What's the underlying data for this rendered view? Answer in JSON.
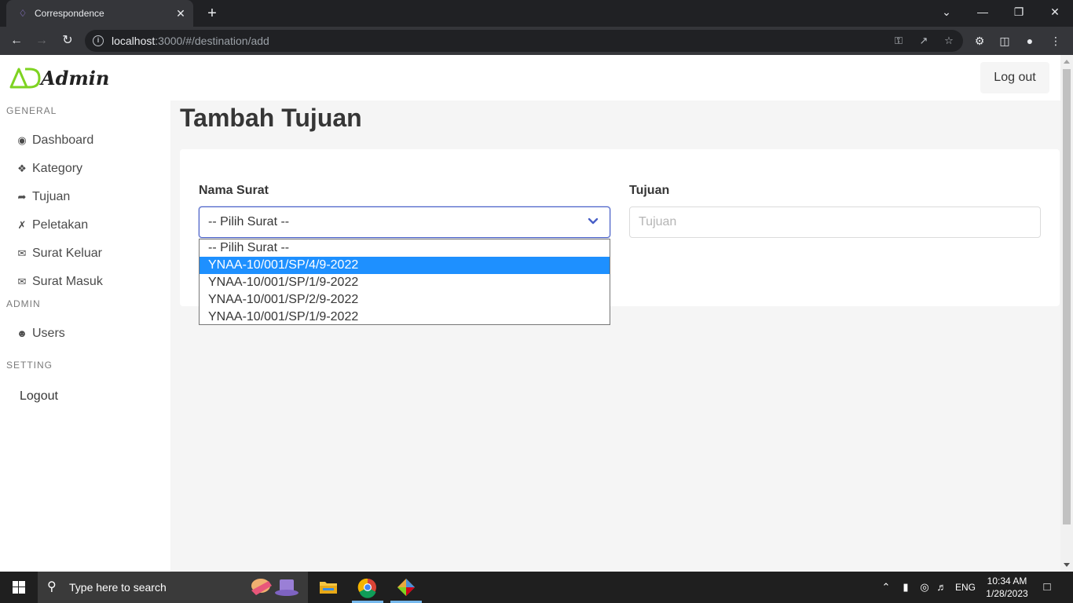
{
  "browser": {
    "tab_title": "Correspondence",
    "url_host": "localhost",
    "url_rest": ":3000/#/destination/add"
  },
  "app": {
    "logo_text": "Admin",
    "logo_mark": "AD",
    "logout_button": "Log out"
  },
  "sidebar": {
    "general_label": "GENERAL",
    "admin_label": "ADMIN",
    "setting_label": "SETTING",
    "items": [
      {
        "label": "Dashboard",
        "icon": "gauge-icon"
      },
      {
        "label": "Kategory",
        "icon": "tags-icon"
      },
      {
        "label": "Tujuan",
        "icon": "share-icon"
      },
      {
        "label": "Peletakan",
        "icon": "xing-icon"
      },
      {
        "label": "Surat Keluar",
        "icon": "envelope-icon"
      },
      {
        "label": "Surat Masuk",
        "icon": "envelope-open-icon"
      }
    ],
    "admin_items": [
      {
        "label": "Users",
        "icon": "user-icon"
      }
    ],
    "setting_items": [
      {
        "label": "Logout"
      }
    ]
  },
  "main": {
    "page_title": "Tambah Tujuan",
    "nama_surat_label": "Nama Surat",
    "tujuan_label": "Tujuan",
    "select_value": "-- Pilih Surat --",
    "tujuan_placeholder": "Tujuan",
    "options": [
      "-- Pilih Surat --",
      "YNAA-10/001/SP/4/9-2022",
      "YNAA-10/001/SP/1/9-2022",
      "YNAA-10/001/SP/2/9-2022",
      "YNAA-10/001/SP/1/9-2022"
    ],
    "highlighted_option_index": 1
  },
  "taskbar": {
    "search_placeholder": "Type here to search",
    "language": "ENG",
    "time": "10:34 AM",
    "date": "1/28/2023"
  },
  "colors": {
    "accent": "#485fc7",
    "highlight": "#1e90ff",
    "logo_green": "#7ed321"
  }
}
